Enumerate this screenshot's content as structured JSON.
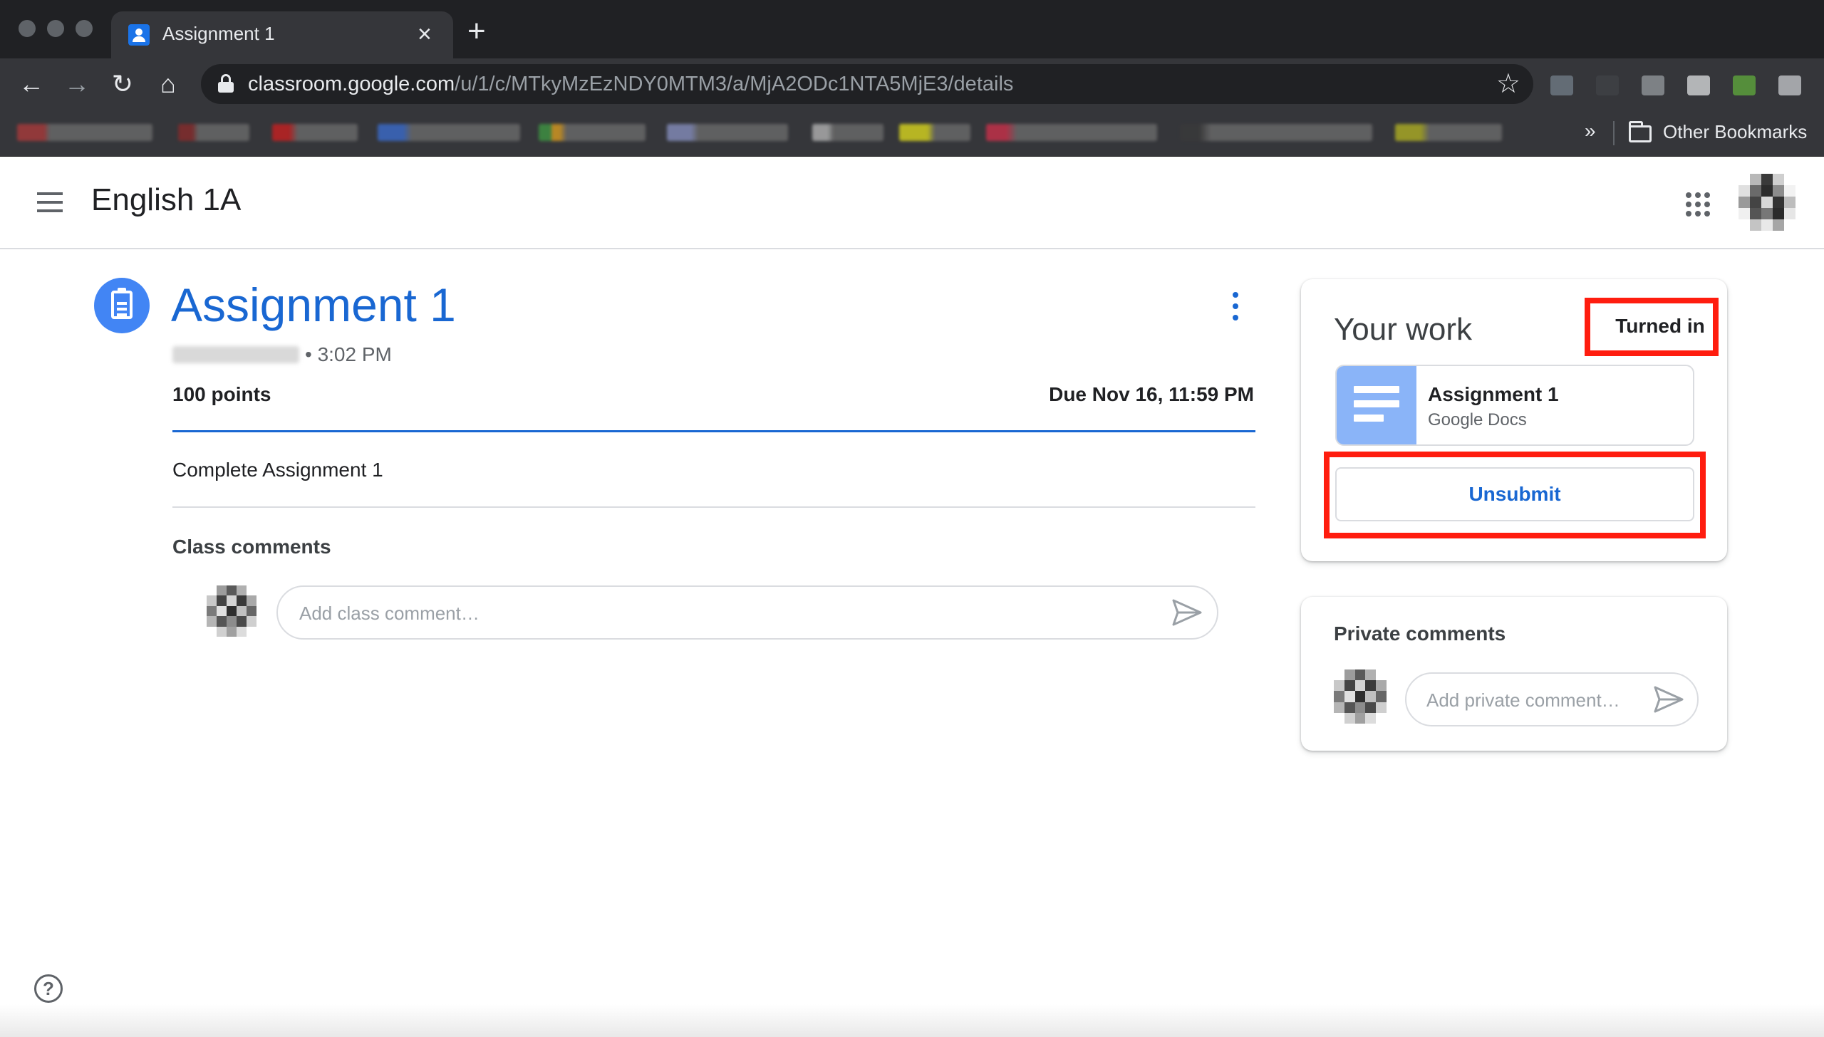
{
  "browser": {
    "tab_title": "Assignment 1",
    "tab_close": "×",
    "new_tab": "+",
    "url_host": "classroom.google.com",
    "url_path": "/u/1/c/MTkyMzEzNDY0MTM3/a/MjA2ODc1NTA5MjE3/details",
    "bookmarks_overflow": "»",
    "other_bookmarks": "Other Bookmarks",
    "icons": {
      "back": "arrow-left",
      "forward": "arrow-right",
      "reload": "reload",
      "home": "home",
      "bookmark_star": "star-outline",
      "lock": "lock",
      "folder": "folder"
    }
  },
  "header": {
    "class_name": "English 1A",
    "menu_icon": "hamburger",
    "apps_icon": "google-apps-grid"
  },
  "assignment": {
    "title": "Assignment 1",
    "posted_time": "• 3:02 PM",
    "points": "100 points",
    "due": "Due Nov 16, 11:59 PM",
    "instructions": "Complete Assignment 1",
    "class_comments_heading": "Class comments",
    "class_comment_placeholder": "Add class comment…"
  },
  "your_work": {
    "heading": "Your work",
    "status": "Turned in",
    "attachment": {
      "title": "Assignment 1",
      "type": "Google Docs"
    },
    "unsubmit_label": "Unsubmit"
  },
  "private_comments": {
    "heading": "Private comments",
    "placeholder": "Add private comment…"
  },
  "colors": {
    "accent_blue": "#1967d2",
    "assignment_icon_blue": "#4285f4",
    "highlight_red": "#ff1d0f",
    "doc_thumb_blue": "#8ab4f8",
    "chrome_dark": "#202124"
  }
}
